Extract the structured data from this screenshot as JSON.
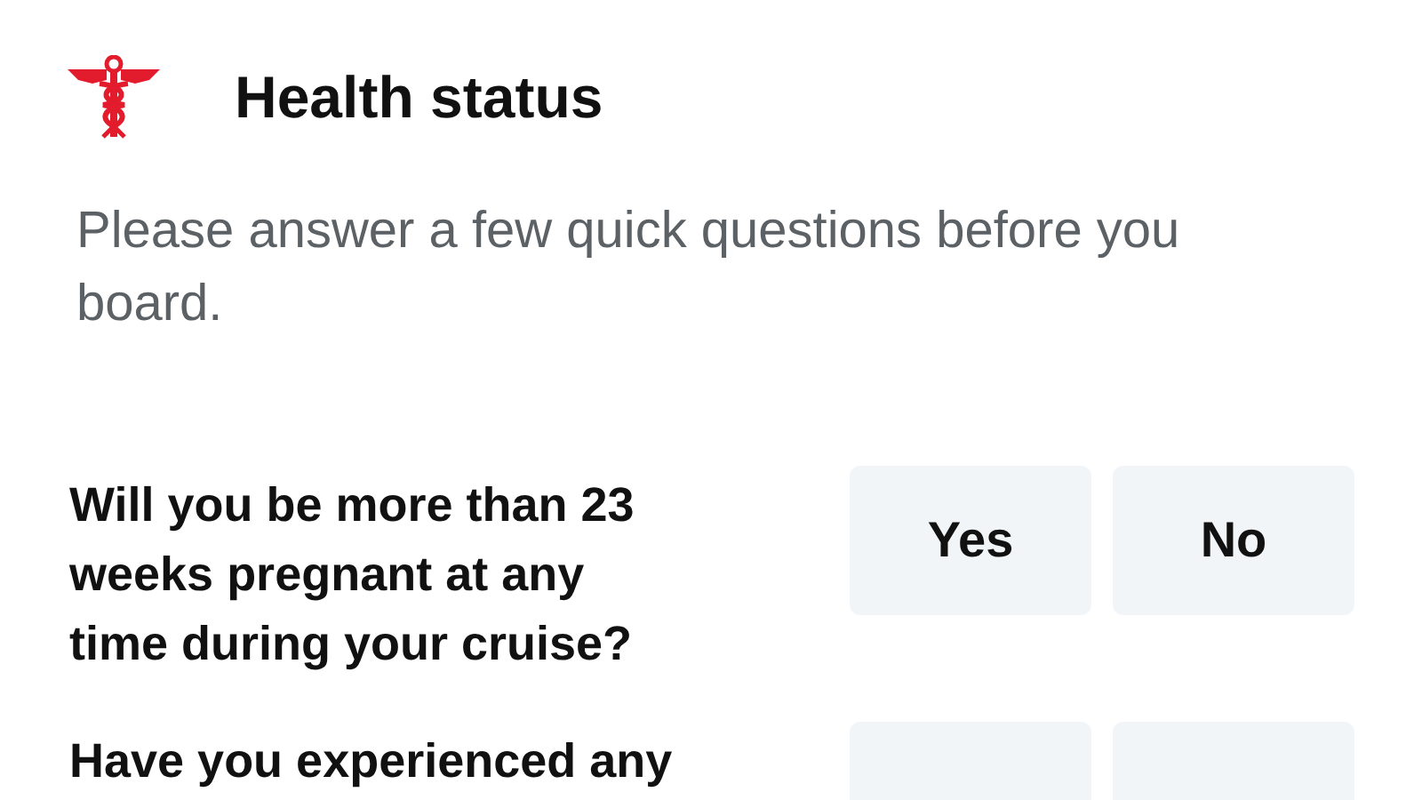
{
  "header": {
    "title": "Health status"
  },
  "intro": "Please answer a few quick questions before you board.",
  "questions": [
    {
      "text": "Will you be more than 23 weeks pregnant at any time during your cruise?",
      "answers": [
        {
          "label": "Yes"
        },
        {
          "label": "No"
        }
      ]
    },
    {
      "text": "Have you experienced any"
    }
  ]
}
